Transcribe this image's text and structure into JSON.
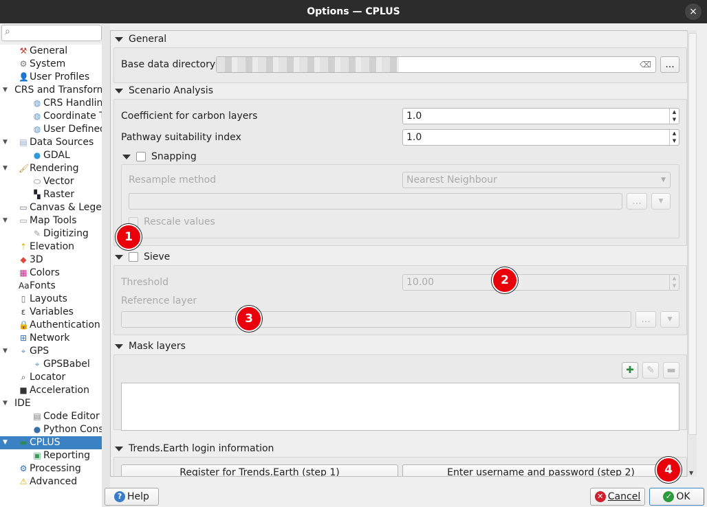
{
  "window": {
    "title": "Options — CPLUS",
    "close_icon": "×"
  },
  "search": {
    "placeholder": ""
  },
  "sidebar": {
    "items": [
      {
        "label": "General",
        "level": 0,
        "icon": "tools-icon",
        "glyph": "⚒",
        "color": "#c0392b"
      },
      {
        "label": "System",
        "level": 0,
        "icon": "system-icon",
        "glyph": "⚙",
        "color": "#777"
      },
      {
        "label": "User Profiles",
        "level": 0,
        "icon": "user-icon",
        "glyph": "👤",
        "color": "#333"
      },
      {
        "label": "CRS and Transformations",
        "level": 0,
        "expander": true,
        "icon": "",
        "glyph": ""
      },
      {
        "label": "CRS Handling",
        "level": 1,
        "icon": "globe-icon",
        "glyph": "◍",
        "color": "#5a8fc7"
      },
      {
        "label": "Coordinate Transforms",
        "level": 1,
        "icon": "globe-icon",
        "glyph": "◍",
        "color": "#5a8fc7"
      },
      {
        "label": "User Defined CRS",
        "level": 1,
        "icon": "globe-icon",
        "glyph": "◍",
        "color": "#5a8fc7"
      },
      {
        "label": "Data Sources",
        "level": 0,
        "expander": true,
        "icon": "table-icon",
        "glyph": "▤",
        "color": "#8aa8d0"
      },
      {
        "label": "GDAL",
        "level": 1,
        "icon": "gdal-icon",
        "glyph": "●",
        "color": "#2e9bd6"
      },
      {
        "label": "Rendering",
        "level": 0,
        "expander": true,
        "icon": "brush-icon",
        "glyph": "🖌",
        "color": "#c58a2c"
      },
      {
        "label": "Vector",
        "level": 1,
        "icon": "vector-icon",
        "glyph": "⬭",
        "color": "#666"
      },
      {
        "label": "Raster",
        "level": 1,
        "icon": "raster-icon",
        "glyph": "▚",
        "color": "#223"
      },
      {
        "label": "Canvas & Legend",
        "level": 0,
        "icon": "canvas-icon",
        "glyph": "▭",
        "color": "#678"
      },
      {
        "label": "Map Tools",
        "level": 0,
        "expander": true,
        "icon": "map-tools-icon",
        "glyph": "▭",
        "color": "#999"
      },
      {
        "label": "Digitizing",
        "level": 1,
        "icon": "digitizing-icon",
        "glyph": "✎",
        "color": "#999"
      },
      {
        "label": "Elevation",
        "level": 0,
        "icon": "elevation-icon",
        "glyph": "⇡",
        "color": "#d4b800"
      },
      {
        "label": "3D",
        "level": 0,
        "icon": "cube-icon",
        "glyph": "◆",
        "color": "#e04a3a"
      },
      {
        "label": "Colors",
        "level": 0,
        "icon": "colors-icon",
        "glyph": "▦",
        "color": "#c03090"
      },
      {
        "label": "Fonts",
        "level": 0,
        "icon": "fonts-icon",
        "glyph": "Aa",
        "color": "#222"
      },
      {
        "label": "Layouts",
        "level": 0,
        "icon": "layouts-icon",
        "glyph": "▯",
        "color": "#666"
      },
      {
        "label": "Variables",
        "level": 0,
        "icon": "epsilon-icon",
        "glyph": "ε",
        "color": "#333"
      },
      {
        "label": "Authentication",
        "level": 0,
        "icon": "lock-icon",
        "glyph": "🔒",
        "color": "#e0a800"
      },
      {
        "label": "Network",
        "level": 0,
        "icon": "network-icon",
        "glyph": "⊞",
        "color": "#3a6ea8"
      },
      {
        "label": "GPS",
        "level": 0,
        "expander": true,
        "icon": "gps-icon",
        "glyph": "⌖",
        "color": "#5a8fc7"
      },
      {
        "label": "GPSBabel",
        "level": 1,
        "icon": "gps-icon",
        "glyph": "⌖",
        "color": "#5a8fc7"
      },
      {
        "label": "Locator",
        "level": 0,
        "icon": "search-icon",
        "glyph": "⌕",
        "color": "#444"
      },
      {
        "label": "Acceleration",
        "level": 0,
        "icon": "chip-icon",
        "glyph": "■",
        "color": "#333"
      },
      {
        "label": "IDE",
        "level": 0,
        "expander": true,
        "icon": "",
        "glyph": ""
      },
      {
        "label": "Code Editor",
        "level": 1,
        "icon": "code-editor-icon",
        "glyph": "▤",
        "color": "#777"
      },
      {
        "label": "Python Console",
        "level": 1,
        "icon": "python-icon",
        "glyph": "●",
        "color": "#3a6ea8"
      },
      {
        "label": "CPLUS",
        "level": 0,
        "expander": true,
        "selected": true,
        "icon": "cplus-icon",
        "glyph": "▬",
        "color": "#2e8b57"
      },
      {
        "label": "Reporting",
        "level": 1,
        "icon": "reporting-icon",
        "glyph": "▣",
        "color": "#3a9a5a"
      },
      {
        "label": "Processing",
        "level": 0,
        "icon": "processing-icon",
        "glyph": "⚙",
        "color": "#2f6db3"
      },
      {
        "label": "Advanced",
        "level": 0,
        "icon": "warning-icon",
        "glyph": "⚠",
        "color": "#e0a800"
      }
    ]
  },
  "general": {
    "title": "General",
    "base_dir_label": "Base data directory",
    "base_dir_value": "",
    "browse": "..."
  },
  "scenario": {
    "title": "Scenario Analysis",
    "carbon_label": "Coefficient for carbon layers",
    "carbon_value": "1.0",
    "suitability_label": "Pathway suitability index",
    "suitability_value": "1.0",
    "snapping": {
      "title": "Snapping",
      "checked": false,
      "resample_label": "Resample method",
      "resample_value": "Nearest Neighbour",
      "browse": "...",
      "rescale_label": "Rescale values",
      "rescale_checked": false
    }
  },
  "sieve": {
    "title": "Sieve",
    "checked": false,
    "threshold_label": "Threshold",
    "threshold_value": "10.00",
    "reference_label": "Reference layer",
    "browse": "..."
  },
  "mask": {
    "title": "Mask layers"
  },
  "trends": {
    "title": "Trends.Earth login information",
    "register": "Register for Trends.Earth (step 1)",
    "login": "Enter username and password (step 2)"
  },
  "annotations": [
    "1",
    "2",
    "3",
    "4"
  ],
  "footer": {
    "help": "Help",
    "cancel": "Cancel",
    "ok": "OK"
  },
  "colors": {
    "selection": "#3a82c4",
    "badge": "#e8000a",
    "ok_icon": "#2e9a3e",
    "cancel_icon": "#d0202e",
    "help_icon": "#3a7cc8"
  }
}
